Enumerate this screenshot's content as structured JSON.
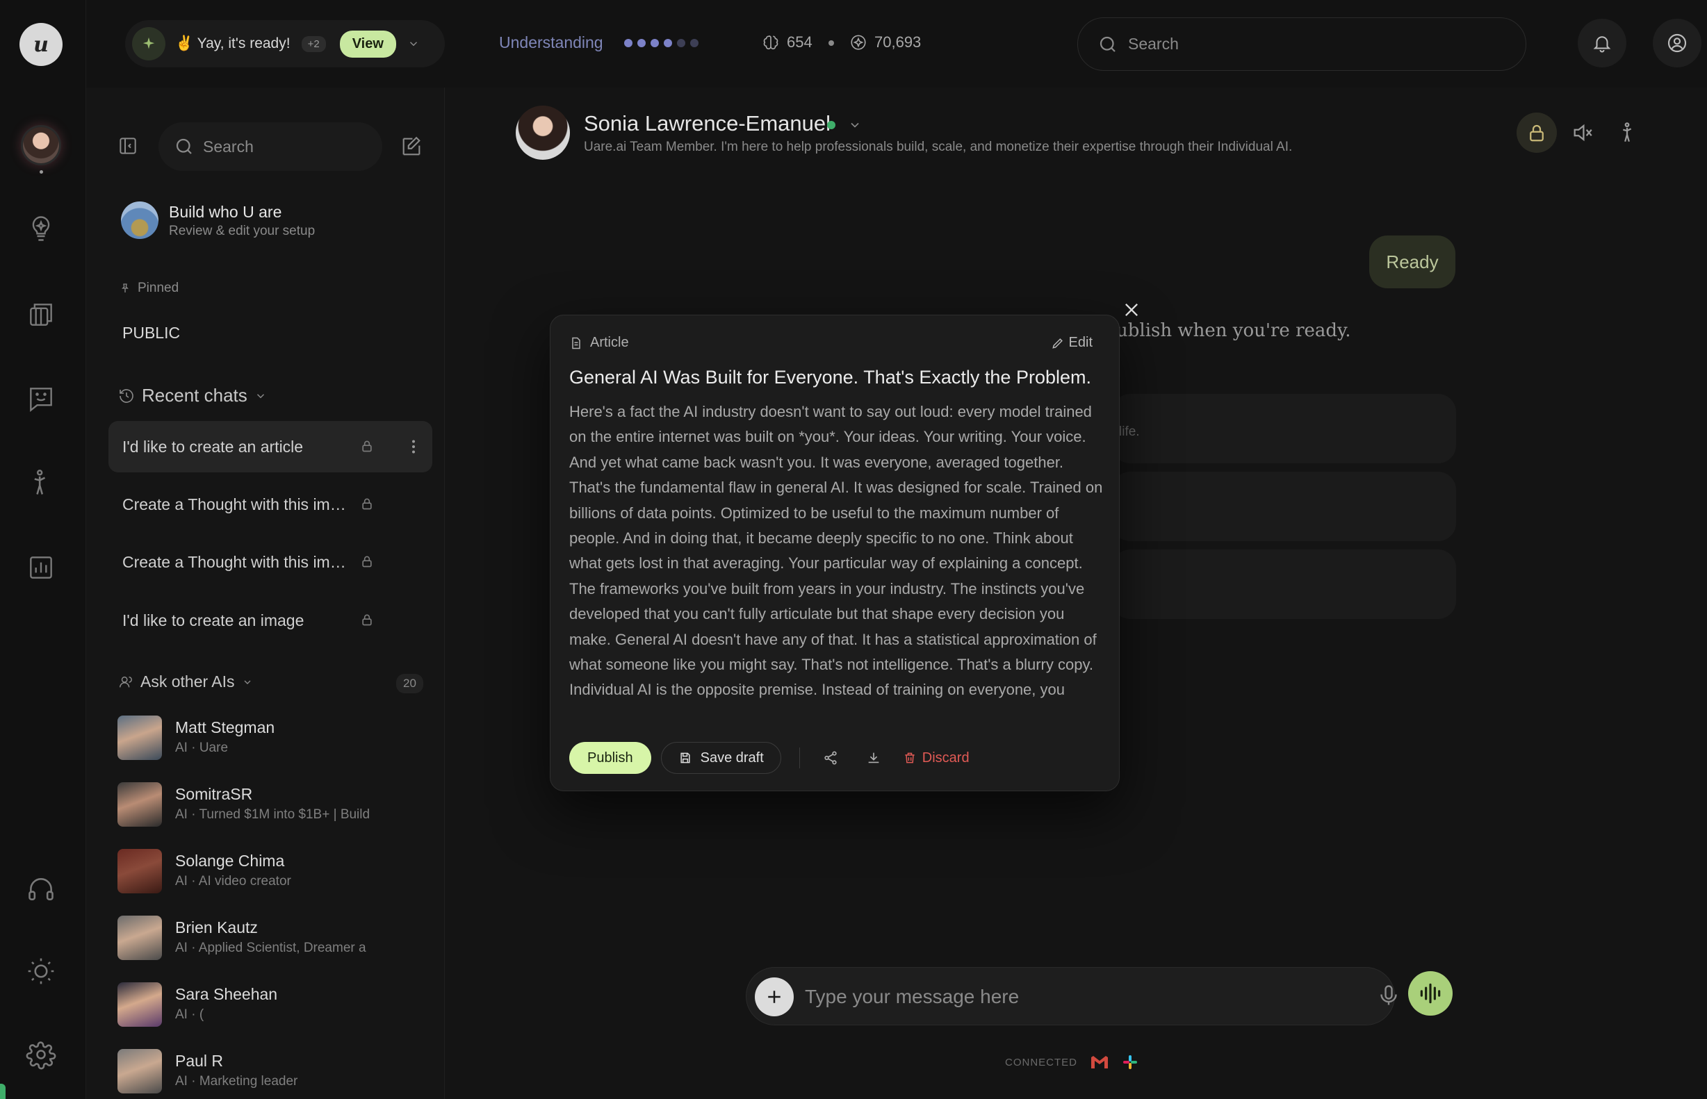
{
  "notification": {
    "emoji": "✌️",
    "text": "Yay, it's ready!",
    "extra": "+2",
    "view_label": "View"
  },
  "progress": {
    "label": "Understanding",
    "dots_filled": 4,
    "dots_total": 6
  },
  "stats": {
    "tokens": "654",
    "credits": "70,693"
  },
  "top_search": {
    "placeholder": "Search"
  },
  "sidebar": {
    "search_placeholder": "Search",
    "build": {
      "title": "Build who U are",
      "subtitle": "Review & edit your setup"
    },
    "pinned_label": "Pinned",
    "public_label": "PUBLIC",
    "recent_label": "Recent chats",
    "recent": [
      {
        "label": "I'd like to create an article"
      },
      {
        "label": "Create a Thought with this image"
      },
      {
        "label": "Create a Thought with this image"
      },
      {
        "label": "I'd like to create an image"
      }
    ],
    "ask_label": "Ask other AIs",
    "ask_count": "20",
    "people": [
      {
        "name": "Matt Stegman",
        "desc": "AI · Uare"
      },
      {
        "name": "SomitraSR",
        "desc": "AI · Turned $1M into $1B+ | Build"
      },
      {
        "name": "Solange Chima",
        "desc": "AI · AI video creator"
      },
      {
        "name": "Brien Kautz",
        "desc": "AI · Applied Scientist, Dreamer a"
      },
      {
        "name": "Sara Sheehan",
        "desc": "AI · ("
      },
      {
        "name": "Paul R",
        "desc": "AI · Marketing leader"
      }
    ]
  },
  "agent": {
    "name": "Sonia Lawrence-Emanuel",
    "description": "Uare.ai Team Member. I'm here to help professionals build, scale, and monetize their expertise through their Individual AI."
  },
  "chat": {
    "user_bubble": "Ready",
    "assistant_fragment": "ublish when you're ready.",
    "card_fragment": "life."
  },
  "article": {
    "type_label": "Article",
    "edit_label": "Edit",
    "title": "General AI Was Built for Everyone. That's Exactly the Problem.",
    "body": "Here's a fact the AI industry doesn't want to say out loud: every model trained on the entire internet was built on *you*. Your ideas. Your writing. Your voice. And yet what came back wasn't you. It was everyone, averaged together. That's the fundamental flaw in general AI. It was designed for scale. Trained on billions of data points. Optimized to be useful to the maximum number of people. And in doing that, it became deeply specific to no one. Think about what gets lost in that averaging. Your particular way of explaining a concept. The frameworks you've built from years in your industry. The instincts you've developed that you can't fully articulate but that shape every decision you make. General AI doesn't have any of that. It has a statistical approximation of what someone like you might say. That's not intelligence. That's a blurry copy. Individual AI is the opposite premise. Instead of training on everyone, you",
    "publish_label": "Publish",
    "save_label": "Save draft",
    "discard_label": "Discard"
  },
  "composer": {
    "placeholder": "Type your message here",
    "connected_label": "CONNECTED"
  },
  "colors": {
    "accent_green": "#d7f5a8",
    "online": "#3fae6a",
    "danger": "#e15a55",
    "understanding": "#7f86b8"
  }
}
